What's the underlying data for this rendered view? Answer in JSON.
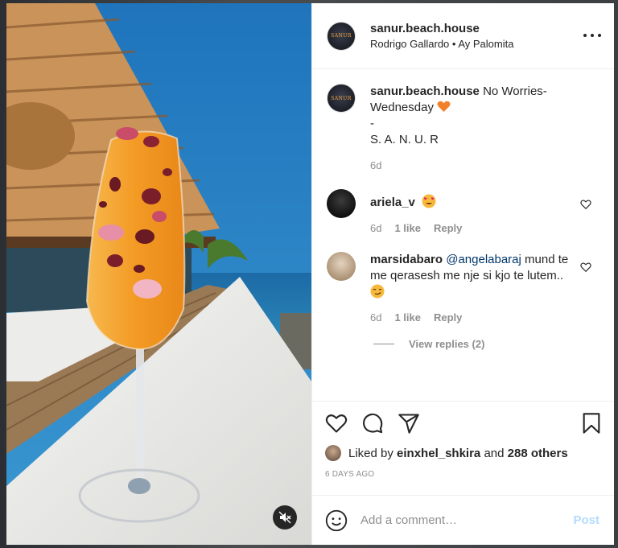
{
  "post": {
    "username": "sanur.beach.house",
    "subtitle": "Rodrigo Gallardo • Ay Palomita",
    "avatar_mark": "SANUR"
  },
  "caption": {
    "author": "sanur.beach.house",
    "text_line1": "No Worries-Wednesday",
    "emoji": "orange-heart",
    "text_line2": "-",
    "text_line3": "S. A. N. U. R",
    "time": "6d"
  },
  "comments": [
    {
      "author": "ariela_v",
      "text": "",
      "emoji": "heart-eyes",
      "time": "6d",
      "likes": "1 like",
      "reply_label": "Reply"
    },
    {
      "author": "marsidabaro",
      "mention": "@angelabaraj",
      "text": "mund te me qerasesh me nje si kjo te lutem..",
      "emoji": "smirk",
      "time": "6d",
      "likes": "1 like",
      "reply_label": "Reply"
    }
  ],
  "view_replies": "View replies (2)",
  "likes": {
    "prefix": "Liked by",
    "user": "einxhel_shkira",
    "middle": "and",
    "others": "288 others"
  },
  "time_ago": "6 DAYS AGO",
  "comment_input": {
    "placeholder": "Add a comment…"
  },
  "post_label": "Post",
  "colors": {
    "sky": "#2e86c6",
    "drink": "#f2a23a",
    "link": "#00376b",
    "post_disabled": "#b3dbff"
  },
  "icons": [
    "mute-icon",
    "more-icon",
    "heart-icon",
    "comment-icon",
    "share-icon",
    "bookmark-icon",
    "emoji-icon"
  ]
}
